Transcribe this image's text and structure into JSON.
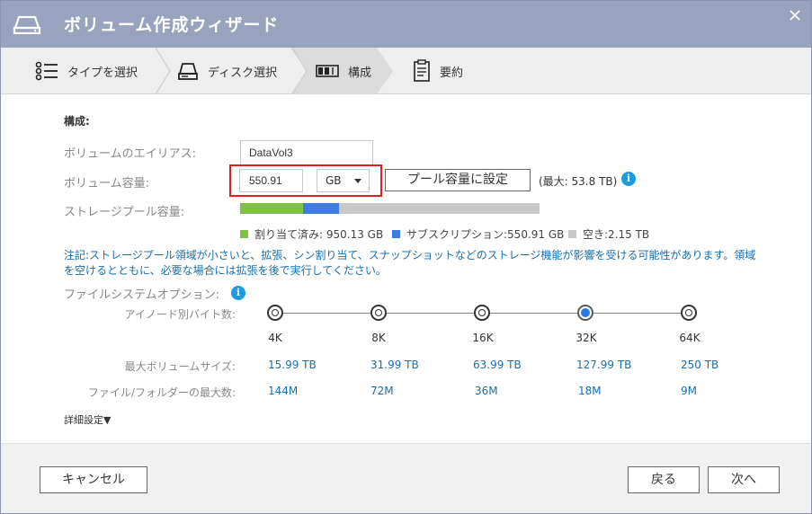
{
  "window": {
    "title": "ボリューム作成ウィザード"
  },
  "steps": [
    {
      "label": "タイプを選択",
      "icon": "list-icon"
    },
    {
      "label": "ディスク選択",
      "icon": "disk-icon"
    },
    {
      "label": "構成",
      "icon": "config-icon",
      "active": true
    },
    {
      "label": "要約",
      "icon": "summary-icon"
    }
  ],
  "config": {
    "section_title": "構成:",
    "alias_label": "ボリュームのエイリアス:",
    "alias_value": "DataVol3",
    "capacity_label": "ボリューム容量:",
    "capacity_value": "550.91",
    "unit": "GB",
    "pool_button": "プール容量に設定",
    "max_text": "(最大: 53.8 TB)",
    "pool_label": "ストレージプール容量:",
    "pool_usage": {
      "allocated_fraction": 0.21,
      "subscription_fraction": 0.12
    },
    "legend": {
      "allocated": "割り当て済み: 950.13 GB",
      "subscription": "サブスクリプション:550.91 GB",
      "free": "空き:2.15 TB"
    },
    "note": "注記:ストレージプール領域が小さいと、拡張、シン割り当て、スナップショットなどのストレージ機能が影響を受ける可能性があります。領域を空けるとともに、必要な場合には拡張を後で実行してください。",
    "fs_label": "ファイルシステムオプション:",
    "inode_label": "アイノード別バイト数:",
    "max_volume_label": "最大ボリュームサイズ:",
    "max_files_label": "ファイル/フォルダーの最大数:",
    "options": [
      {
        "size": "4K",
        "max_volume": "15.99 TB",
        "max_files": "144M"
      },
      {
        "size": "8K",
        "max_volume": "31.99 TB",
        "max_files": "72M"
      },
      {
        "size": "16K",
        "max_volume": "63.99 TB",
        "max_files": "36M"
      },
      {
        "size": "32K",
        "max_volume": "127.99 TB",
        "max_files": "18M",
        "selected": true
      },
      {
        "size": "64K",
        "max_volume": "250 TB",
        "max_files": "9M"
      }
    ],
    "advanced": "詳細設定▼"
  },
  "footer": {
    "cancel": "キャンセル",
    "back": "戻る",
    "next": "次へ"
  },
  "colors": {
    "allocated": "#7dc242",
    "subscription": "#3f7be0",
    "free": "#c8c8c8",
    "accent": "#1a9be2"
  }
}
